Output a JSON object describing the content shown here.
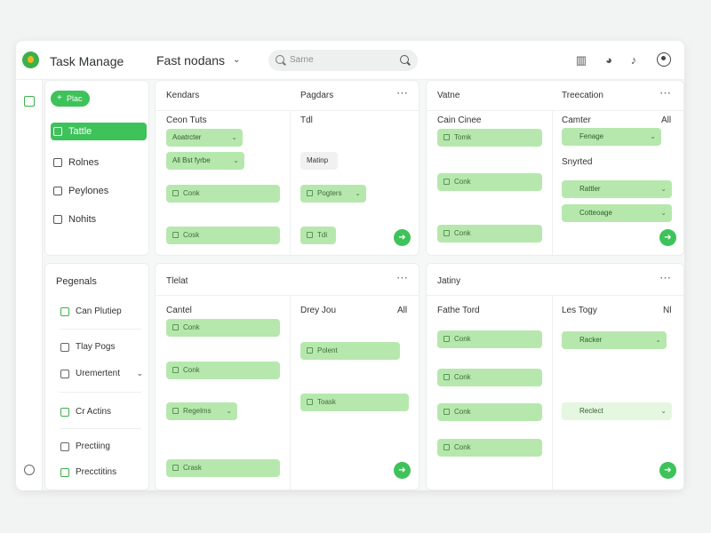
{
  "app": {
    "title": "Task Manage",
    "workspace": "Fast nodans"
  },
  "search": {
    "placeholder": "Sarne"
  },
  "sidebar": {
    "new_label": "Plac",
    "items": [
      {
        "label": "Tattle"
      },
      {
        "label": "Rolnes"
      },
      {
        "label": "Peylones"
      },
      {
        "label": "Nohits"
      }
    ]
  },
  "bottom_nav": {
    "heading": "Pegenals",
    "items": [
      {
        "label": "Can Plutiep"
      },
      {
        "label": "Tlay Pogs"
      },
      {
        "label": "Uremertent"
      },
      {
        "label": "Cr Actins"
      },
      {
        "label": "Prectiing"
      },
      {
        "label": "Precctitins"
      }
    ]
  },
  "boards": [
    {
      "columns": [
        {
          "title": "Kendars",
          "sub": "Ceon Tuts",
          "chips": [
            "Aoatrcter",
            "All Bst fyrbe"
          ],
          "cards": [
            "Conk",
            "Cosk"
          ]
        },
        {
          "title": "Pagdars",
          "sub": "Tdl",
          "chips": [
            "Matinp"
          ],
          "cards": [
            "Pogters",
            "Tdi"
          ]
        }
      ]
    },
    {
      "columns": [
        {
          "title": "Vatne",
          "sub": "Cain Cinee",
          "cards": [
            "Tomk",
            "Conk",
            "Conk"
          ]
        },
        {
          "title": "Treecation",
          "sub": "Camter",
          "extra": "All",
          "chips": [
            "Fenage",
            "Snyrted",
            "Rattler",
            "Cotteoage"
          ]
        }
      ]
    },
    {
      "title": "Tlelat",
      "columns": [
        {
          "sub": "Cantel",
          "cards": [
            "Conk",
            "Conk",
            "Regelms",
            "Crask"
          ]
        },
        {
          "sub": "Drey Jou",
          "extra": "All",
          "cards": [
            "Polent",
            "Toask"
          ]
        }
      ]
    },
    {
      "title": "Jatiny",
      "columns": [
        {
          "sub": "Fathe Tord",
          "cards": [
            "Conk",
            "Conk",
            "Conk",
            "Conk"
          ]
        },
        {
          "sub": "Les Togy",
          "extra": "Nl",
          "chips": [
            "Racker",
            "Reclect"
          ]
        }
      ]
    }
  ],
  "colors": {
    "accent": "#3ec25a",
    "card": "#b6e8ad",
    "card_text": "#3f6d3c"
  }
}
